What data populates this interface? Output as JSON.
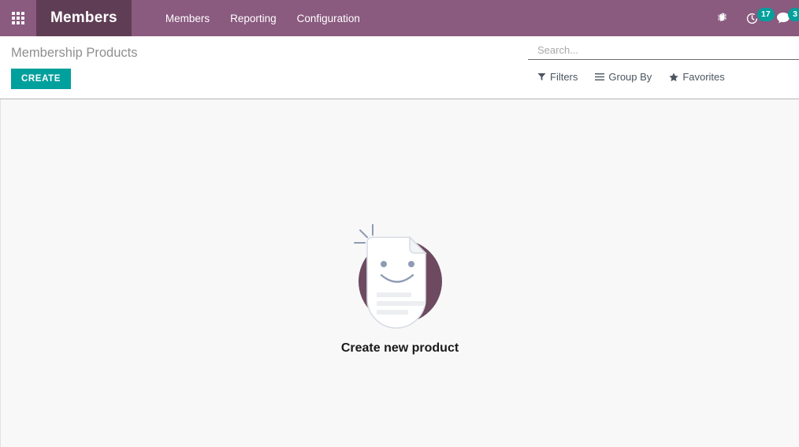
{
  "navbar": {
    "apps_icon": "apps-grid-icon",
    "brand": "Members",
    "menus": [
      {
        "label": "Members"
      },
      {
        "label": "Reporting"
      },
      {
        "label": "Configuration"
      }
    ],
    "systray": {
      "debug": {
        "icon": "bug-icon",
        "title": "Debug"
      },
      "activity": {
        "icon": "clock-icon",
        "count": "17"
      },
      "messaging": {
        "icon": "chat-icon",
        "count": "3"
      }
    },
    "colors": {
      "navbar_bg": "#8a5a7f",
      "brand_bg": "#5f3e55",
      "badge_bg": "#00a09d"
    }
  },
  "control_panel": {
    "breadcrumb": "Membership Products",
    "create_label": "CREATE",
    "create_color": "#00a09d",
    "search": {
      "placeholder": "Search...",
      "value": ""
    },
    "tools": [
      {
        "label": "Filters",
        "icon": "filter-icon"
      },
      {
        "label": "Group By",
        "icon": "list-icon"
      },
      {
        "label": "Favorites",
        "icon": "star-icon"
      }
    ]
  },
  "main": {
    "empty_state": {
      "illustration": "smiling-document-illustration",
      "title": "Create new product",
      "circle_color": "#6d4a5f",
      "paper_color": "#ffffff",
      "accent_color": "#8f9bb3"
    },
    "background_color": "#f8f8f8"
  }
}
